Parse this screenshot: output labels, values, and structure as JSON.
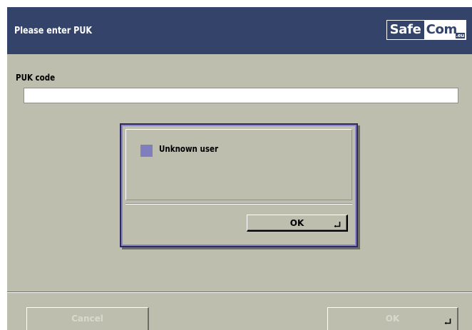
{
  "header": {
    "title": "Please enter PUK",
    "logo": {
      "left": "Safe",
      "right": "Com",
      "suffix": ".eu"
    }
  },
  "form": {
    "puk_label": "PUK code",
    "puk_value": ""
  },
  "dialog": {
    "message": "Unknown user",
    "ok_label": "OK"
  },
  "footer": {
    "cancel_label": "Cancel",
    "ok_label": "OK"
  },
  "colors": {
    "header_bg": "#33436a",
    "screen_bg": "#bdbead",
    "status_square": "#807ebd",
    "dialog_border": "#2e2a5c"
  },
  "icons": [
    "enter-key-icon"
  ]
}
